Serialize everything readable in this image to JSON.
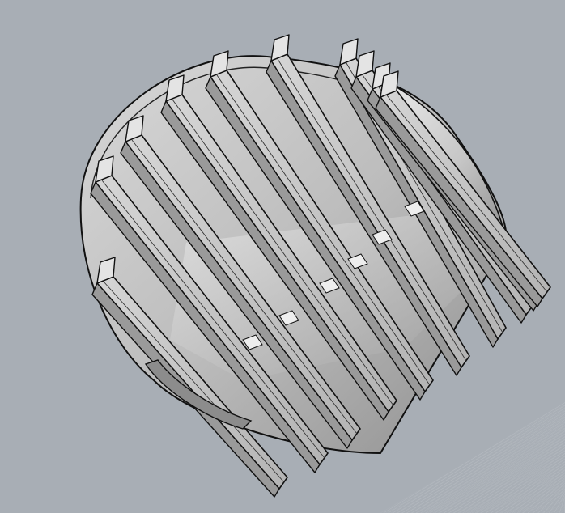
{
  "viewport": {
    "background_color": "#a8aeb5",
    "grid_color": "#b9bec4",
    "part_name": "",
    "view_mode": "shaded"
  },
  "model": {
    "fin_count": 10,
    "fill_light": "#e4e4e4",
    "fill_mid": "#c9c9c9",
    "fill_dark": "#9a9a9a",
    "edge_color": "#111111"
  }
}
